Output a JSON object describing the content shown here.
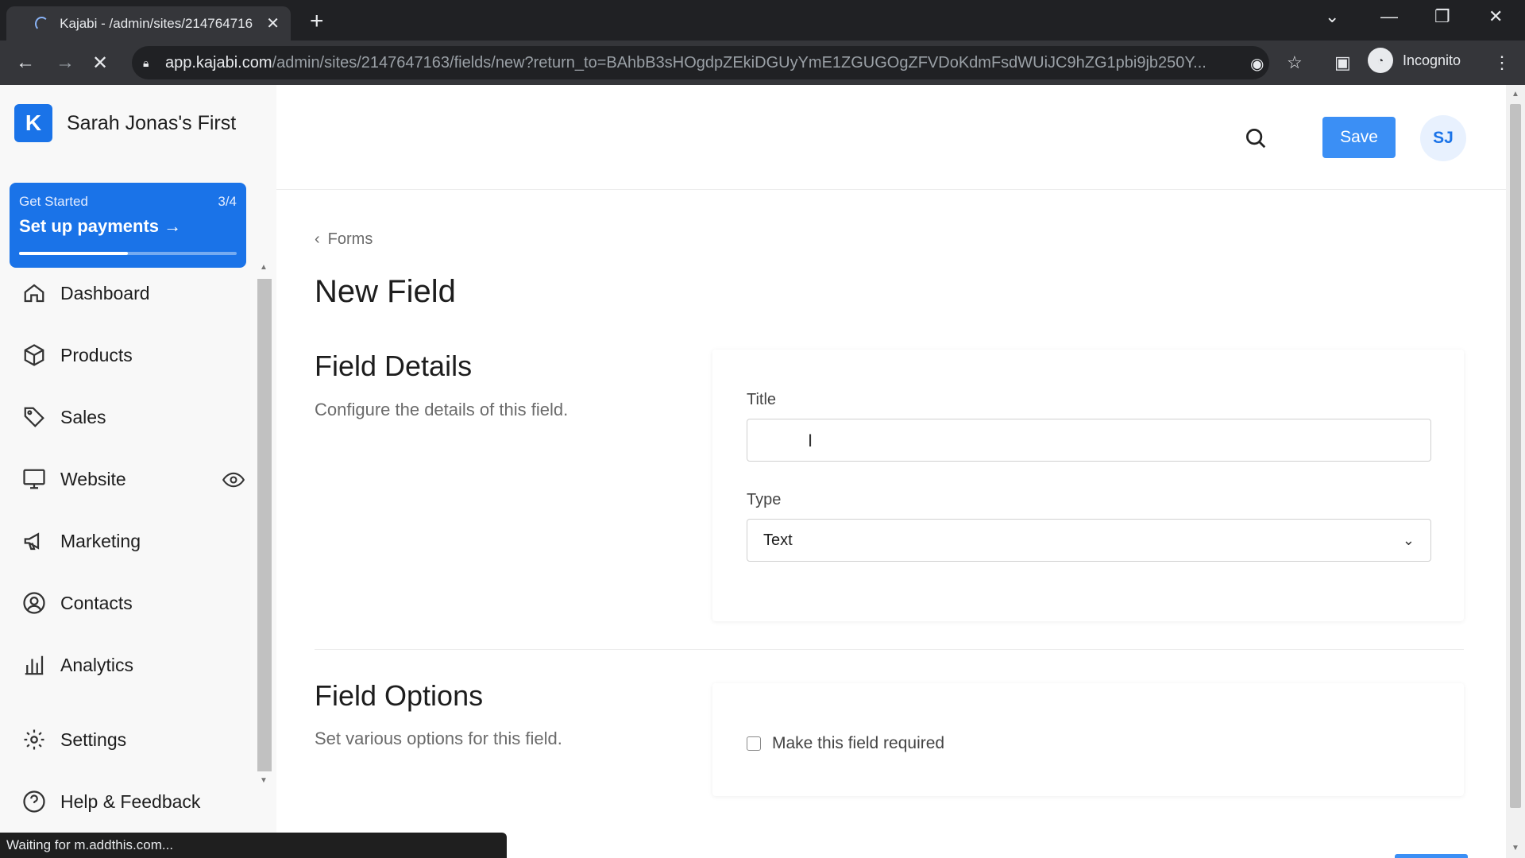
{
  "browser": {
    "tab_title": "Kajabi - /admin/sites/214764716",
    "url_host": "app.kajabi.com",
    "url_path": "/admin/sites/2147647163/fields/new?return_to=BAhbB3sHOgdpZEkiDGUyYmE1ZGUGOgZFVDoKdmFsdWUiJC9hZG1pbi9jb250Y...",
    "profile_label": "Incognito",
    "status_text": "Waiting for m.addthis.com..."
  },
  "sidebar": {
    "site_name": "Sarah Jonas's First",
    "get_started": {
      "label": "Get Started",
      "progress_text": "3/4",
      "action": "Set up payments",
      "progress": 0.5
    },
    "items": [
      {
        "label": "Dashboard",
        "icon": "home-icon"
      },
      {
        "label": "Products",
        "icon": "box-icon"
      },
      {
        "label": "Sales",
        "icon": "tag-icon"
      },
      {
        "label": "Website",
        "icon": "monitor-icon"
      },
      {
        "label": "Marketing",
        "icon": "megaphone-icon"
      },
      {
        "label": "Contacts",
        "icon": "user-circle-icon"
      },
      {
        "label": "Analytics",
        "icon": "bar-chart-icon"
      },
      {
        "label": "Settings",
        "icon": "gear-icon"
      },
      {
        "label": "Help & Feedback",
        "icon": "help-icon"
      }
    ]
  },
  "header": {
    "save_label": "Save",
    "avatar_initials": "SJ"
  },
  "main": {
    "breadcrumb": "Forms",
    "page_title": "New Field",
    "details": {
      "title": "Field Details",
      "description": "Configure the details of this field.",
      "title_label": "Title",
      "title_value": "",
      "type_label": "Type",
      "type_value": "Text"
    },
    "options": {
      "title": "Field Options",
      "description": "Set various options for this field.",
      "required_label": "Make this field required",
      "required_checked": false
    }
  },
  "colors": {
    "accent": "#3b8ff5",
    "brand": "#1a73e8"
  }
}
